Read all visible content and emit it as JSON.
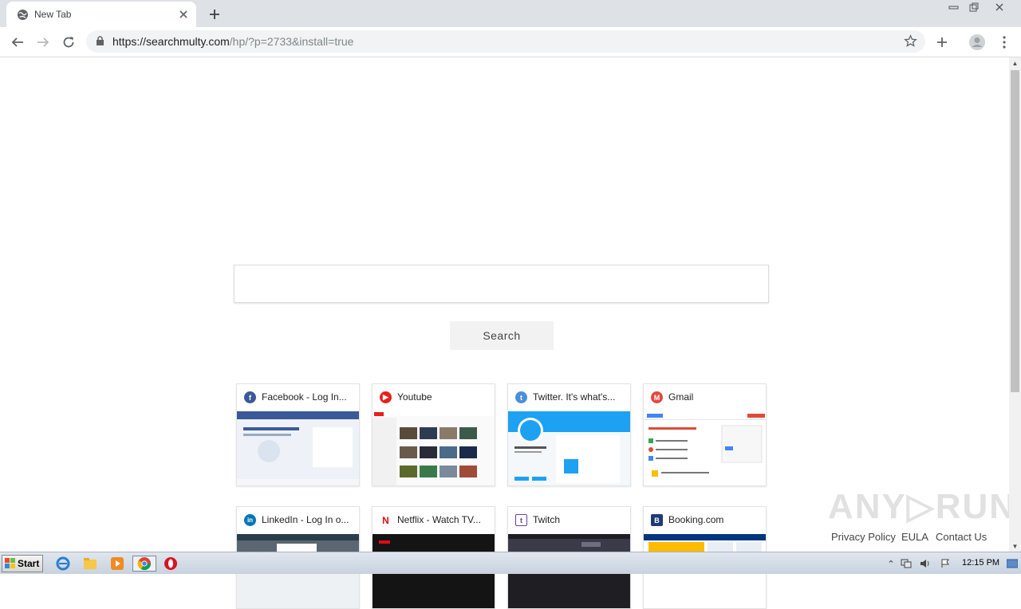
{
  "browser": {
    "tab": {
      "title": "New Tab"
    },
    "url": {
      "host": "https://searchmulty.com",
      "path": "/hp/?p=2733&install=true"
    }
  },
  "page": {
    "search": {
      "placeholder": "",
      "button_label": "Search"
    },
    "tiles": [
      {
        "name": "Facebook - Log In...",
        "icon": "f",
        "icon_color": "#3b5998"
      },
      {
        "name": "Youtube",
        "icon": "▶",
        "icon_color": "#e62117"
      },
      {
        "name": "Twitter. It's what's...",
        "icon": "t",
        "icon_color": "#4a90d9"
      },
      {
        "name": "Gmail",
        "icon": "M",
        "icon_color": "#e04a3f"
      },
      {
        "name": "LinkedIn - Log In o...",
        "icon": "in",
        "icon_color": "#0077b5"
      },
      {
        "name": "Netflix - Watch TV...",
        "icon": "N",
        "icon_color": "#e50914"
      },
      {
        "name": "Twitch",
        "icon": "t",
        "icon_color": "#6441a5"
      },
      {
        "name": "Booking.com",
        "icon": "B",
        "icon_color": "#1f3b75"
      }
    ],
    "footer": {
      "privacy": "Privacy Policy",
      "eula": "EULA",
      "contact": "Contact Us"
    },
    "watermark": "ANY RUN"
  },
  "taskbar": {
    "start_label": "Start",
    "clock": "12:15 PM"
  }
}
